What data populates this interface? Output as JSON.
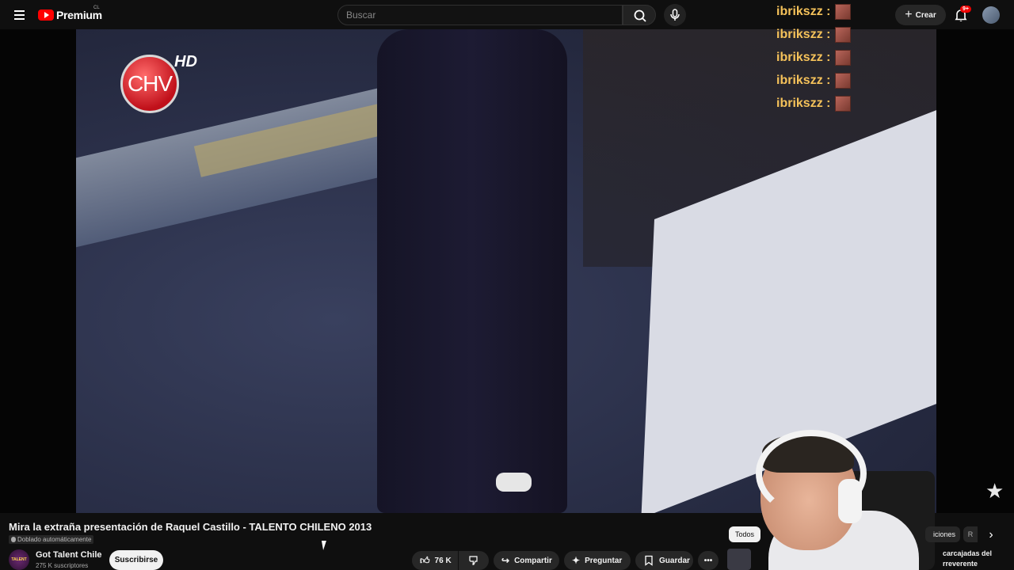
{
  "header": {
    "logo_text": "Premium",
    "country_code": "CL",
    "search_placeholder": "Buscar",
    "create_label": "Crear",
    "notifications_badge": "9+"
  },
  "chat": {
    "lines": [
      {
        "user": "ibrikszz :"
      },
      {
        "user": "ibrikszz :"
      },
      {
        "user": "ibrikszz :"
      },
      {
        "user": "ibrikszz :"
      },
      {
        "user": "ibrikszz :"
      }
    ]
  },
  "video": {
    "channel_logo": "CHV",
    "hd_label": "HD"
  },
  "info": {
    "title": "Mira la extraña presentación de Raquel Castillo - TALENTO CHILENO 2013",
    "dub_label": "Doblado automáticamente",
    "channel_name": "Got Talent Chile",
    "channel_avatar_text": "TALENT",
    "subscribers": "275 K suscriptores",
    "subscribe_label": "Suscribirse"
  },
  "actions": {
    "likes": "76 K",
    "share": "Compartir",
    "ask": "Preguntar",
    "save": "Guardar"
  },
  "related": {
    "chip_all": "Todos",
    "chip_2": "iciones",
    "chip_3": "R",
    "first_title": "carcajadas del rreverente"
  },
  "colors": {
    "brand_red": "#ff0000",
    "chat_name": "#f5c25a",
    "background": "#0f0f0f"
  }
}
